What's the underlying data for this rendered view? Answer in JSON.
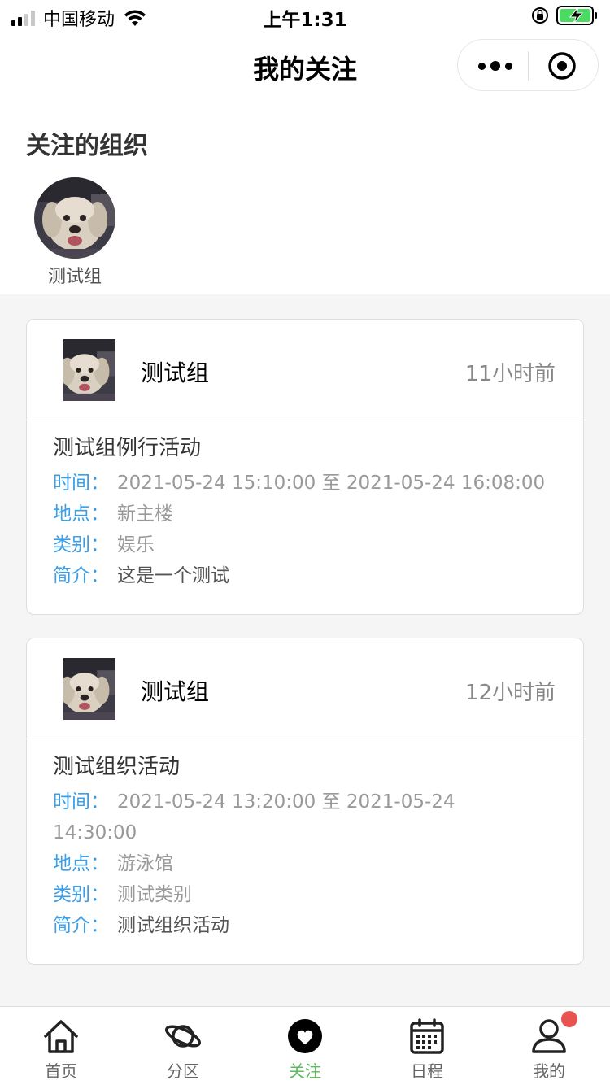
{
  "status_bar": {
    "carrier": "中国移动",
    "time": "上午1:31"
  },
  "nav": {
    "title": "我的关注"
  },
  "followed_orgs": {
    "title": "关注的组织",
    "items": [
      {
        "name": "测试组"
      }
    ]
  },
  "posts": [
    {
      "org": "测试组",
      "time_ago": "11小时前",
      "title": "测试组例行活动",
      "time_label": "时间：",
      "time_value": "2021-05-24 15:10:00 至 2021-05-24 16:08:00",
      "place_label": "地点：",
      "place_value": "新主楼",
      "category_label": "类别：",
      "category_value": "娱乐",
      "intro_label": "简介：",
      "intro_value": "这是一个测试"
    },
    {
      "org": "测试组",
      "time_ago": "12小时前",
      "title": "测试组织活动",
      "time_label": "时间：",
      "time_value": "2021-05-24 13:20:00 至 2021-05-24 14:30:00",
      "place_label": "地点：",
      "place_value": "游泳馆",
      "category_label": "类别：",
      "category_value": "测试类别",
      "intro_label": "简介：",
      "intro_value": "测试组织活动"
    }
  ],
  "tabbar": {
    "items": [
      {
        "label": "首页",
        "icon": "home-icon"
      },
      {
        "label": "分区",
        "icon": "planet-icon"
      },
      {
        "label": "关注",
        "icon": "heart-icon"
      },
      {
        "label": "日程",
        "icon": "calendar-icon"
      },
      {
        "label": "我的",
        "icon": "user-icon"
      }
    ],
    "active_color": "#5dbb5d"
  },
  "colors": {
    "label_blue": "#3b9fe8",
    "badge_red": "#e8534f"
  }
}
